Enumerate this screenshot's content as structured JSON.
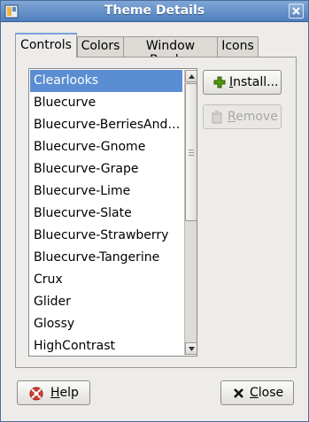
{
  "window": {
    "title": "Theme Details"
  },
  "tabs": [
    {
      "label": "Controls",
      "active": true
    },
    {
      "label": "Colors",
      "active": false
    },
    {
      "label": "Window Border",
      "active": false
    },
    {
      "label": "Icons",
      "active": false
    }
  ],
  "themes": {
    "items": [
      "Clearlooks",
      "Bluecurve",
      "Bluecurve-BerriesAnd…",
      "Bluecurve-Gnome",
      "Bluecurve-Grape",
      "Bluecurve-Lime",
      "Bluecurve-Slate",
      "Bluecurve-Strawberry",
      "Bluecurve-Tangerine",
      "Crux",
      "Glider",
      "Glossy",
      "HighContrast"
    ],
    "selected": "Clearlooks"
  },
  "buttons": {
    "install": {
      "mnemonic": "I",
      "rest": "nstall..."
    },
    "remove": {
      "mnemonic": "R",
      "rest": "emove"
    },
    "help": {
      "mnemonic": "H",
      "rest": "elp"
    },
    "close": {
      "mnemonic": "C",
      "rest": "lose"
    }
  },
  "colors": {
    "titlebar": "#5b86c0",
    "selection": "#5b8dd3",
    "tab_highlight": "#7aa3d6"
  }
}
